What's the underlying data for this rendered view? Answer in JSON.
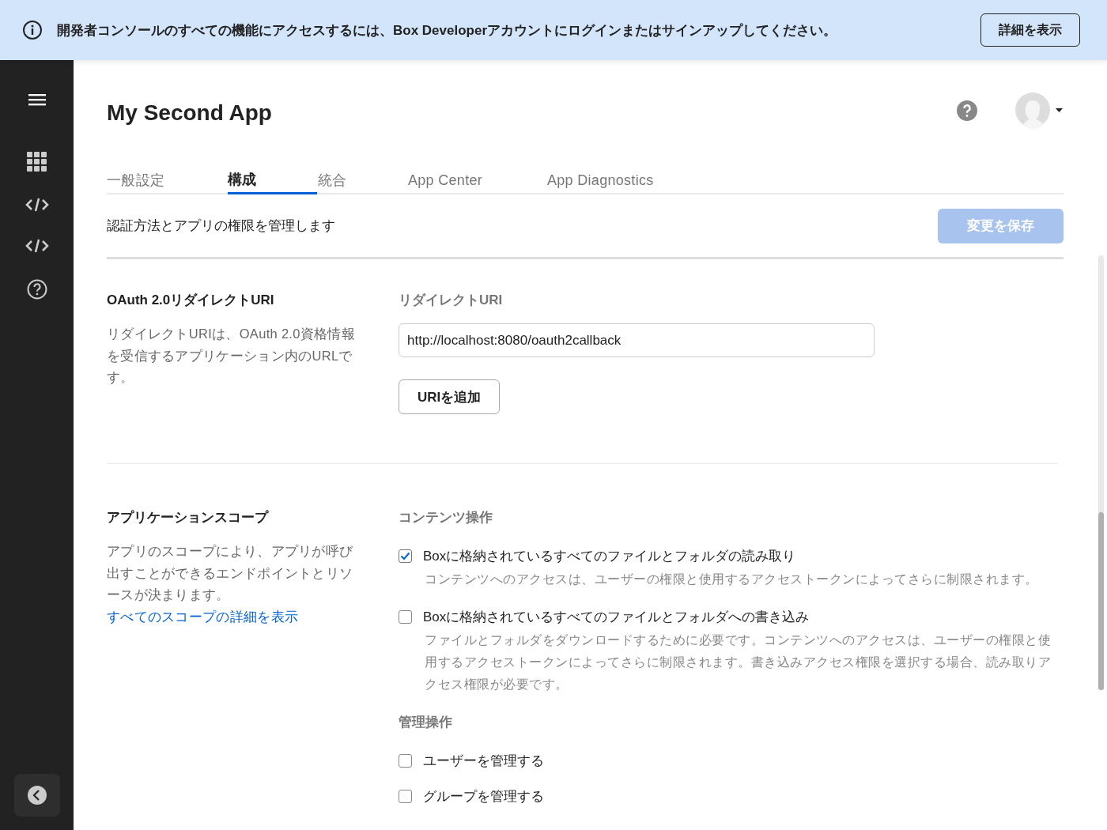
{
  "banner": {
    "message": "開発者コンソールのすべての機能にアクセスするには、Box Developerアカウントにログインまたはサインアップしてください。",
    "button": "詳細を表示"
  },
  "app": {
    "title": "My Second App"
  },
  "tabs": [
    {
      "label": "一般設定",
      "selected": false
    },
    {
      "label": "構成",
      "selected": true
    },
    {
      "label": "統合",
      "selected": false
    },
    {
      "label": "App Center",
      "selected": false
    },
    {
      "label": "App Diagnostics",
      "selected": false
    }
  ],
  "subheader": {
    "description": "認証方法とアプリの権限を管理します",
    "save_button": "変更を保存",
    "save_disabled": true
  },
  "redirect_section": {
    "title": "OAuth 2.0リダイレクトURI",
    "description": "リダイレクトURIは、OAuth 2.0資格情報を受信するアプリケーション内のURLです。",
    "field_label": "リダイレクトURI",
    "uri_value": "http://localhost:8080/oauth2callback",
    "add_button": "URIを追加"
  },
  "scope_section": {
    "title": "アプリケーションスコープ",
    "description": "アプリのスコープにより、アプリが呼び出すことができるエンドポイントとリソースが決まります。",
    "link": "すべてのスコープの詳細を表示",
    "groups": [
      {
        "heading": "コンテンツ操作",
        "options": [
          {
            "label": "Boxに格納されているすべてのファイルとフォルダの読み取り",
            "description": "コンテンツへのアクセスは、ユーザーの権限と使用するアクセストークンによってさらに制限されます。",
            "checked": true
          },
          {
            "label": "Boxに格納されているすべてのファイルとフォルダへの書き込み",
            "description": "ファイルとフォルダをダウンロードするために必要です。コンテンツへのアクセスは、ユーザーの権限と使用するアクセストークンによってさらに制限されます。書き込みアクセス権限を選択する場合、読み取りアクセス権限が必要です。",
            "checked": false
          }
        ]
      },
      {
        "heading": "管理操作",
        "options": [
          {
            "label": "ユーザーを管理する",
            "checked": false
          },
          {
            "label": "グループを管理する",
            "checked": false
          }
        ]
      }
    ]
  }
}
